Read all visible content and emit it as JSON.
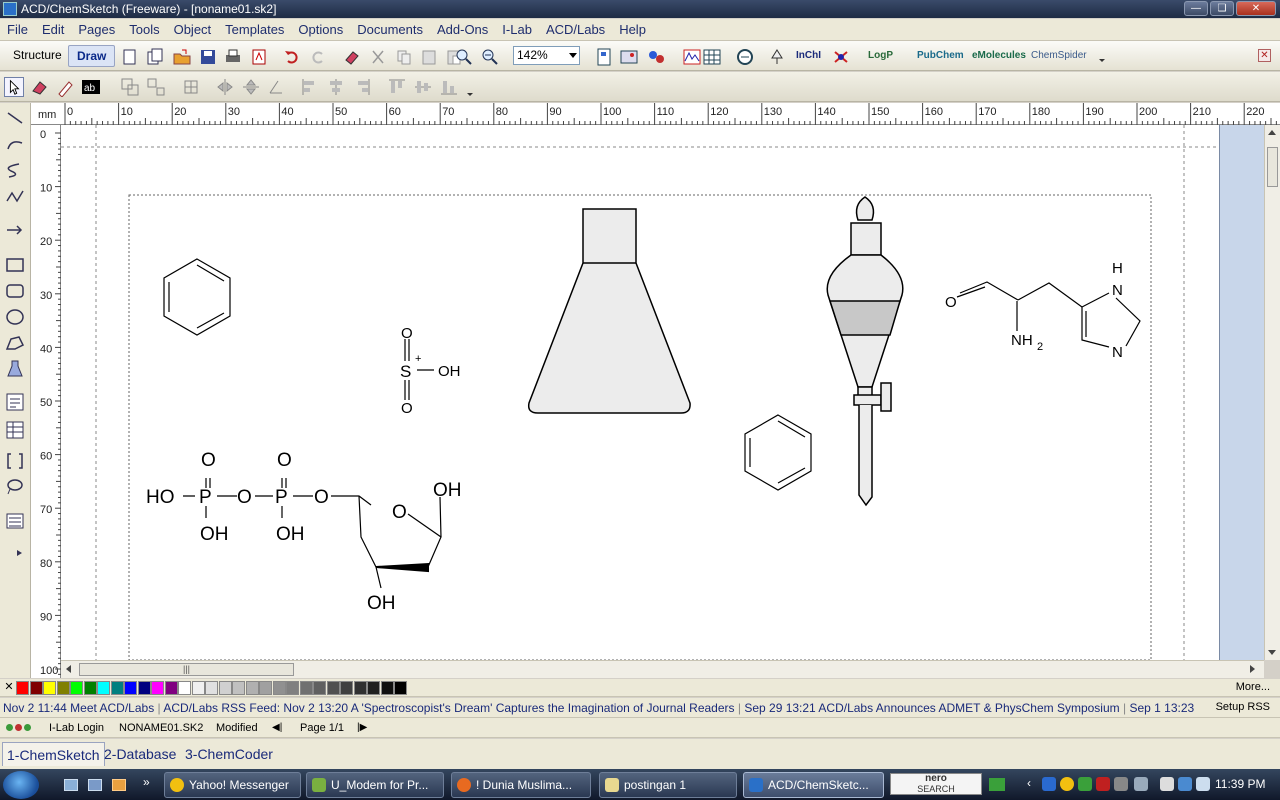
{
  "window": {
    "title": "ACD/ChemSketch (Freeware) - [noname01.sk2]"
  },
  "menu": [
    "File",
    "Edit",
    "Pages",
    "Tools",
    "Object",
    "Templates",
    "Options",
    "Documents",
    "Add-Ons",
    "I-Lab",
    "ACD/Labs",
    "Help"
  ],
  "toolbar1": {
    "structure_label": "Structure",
    "draw_label": "Draw",
    "zoom_value": "142%",
    "inchi_label": "InChI",
    "logp_label": "LogP",
    "pubchem_label": "PubChem",
    "emolecules_label": "eMolecules",
    "chemspider_label": "ChemSpider"
  },
  "hruler": {
    "unit": "mm",
    "ticks": [
      "0",
      "10",
      "20",
      "30",
      "40",
      "50",
      "60",
      "70",
      "80",
      "90",
      "100",
      "110",
      "120",
      "130",
      "140",
      "150",
      "160",
      "170",
      "180",
      "190",
      "200",
      "210",
      "220"
    ]
  },
  "vruler": {
    "ticks": [
      "0",
      "10",
      "20",
      "30",
      "40",
      "50",
      "60",
      "70",
      "80",
      "90",
      "100"
    ]
  },
  "molecules": {
    "sulfonic": {
      "o_top": "O",
      "s": "S",
      "charge": "+",
      "oh": "OH",
      "o_bottom": "O"
    },
    "sugar_phosphate": {
      "ho": "HO",
      "p1": "P",
      "o1": "O",
      "p2": "P",
      "o2": "O",
      "o_top1": "O",
      "o_top2": "O",
      "oh1": "OH",
      "oh2": "OH",
      "oh_right": "OH",
      "oh_bottom": "OH",
      "ring_o": "O"
    },
    "histidinal": {
      "o": "O",
      "nh2": "NH",
      "nh2_sub": "2",
      "h": "H",
      "n1": "N",
      "n2": "N"
    }
  },
  "palette": {
    "more_label": "More...",
    "colors": [
      "#ff0000",
      "#800000",
      "#ffff00",
      "#808000",
      "#00ff00",
      "#008000",
      "#00ffff",
      "#008080",
      "#0000ff",
      "#000080",
      "#ff00ff",
      "#800080",
      "#ffffff",
      "#f0f0f0",
      "#e0e0e0",
      "#d0d0d0",
      "#c0c0c0",
      "#b0b0b0",
      "#a0a0a0",
      "#909090",
      "#808080",
      "#707070",
      "#606060",
      "#505050",
      "#404040",
      "#303030",
      "#202020",
      "#101010",
      "#000000"
    ]
  },
  "news": {
    "items": [
      "Nov 2 11:44 Meet ACD/Labs",
      "ACD/Labs RSS Feed: Nov 2 13:20 A 'Spectroscopist's Dream' Captures the Imagination of Journal Readers",
      "Sep 29 13:21 ACD/Labs Announces ADMET & PhysChem Symposium",
      "Sep 1 13:23"
    ],
    "setup_label": "Setup RSS"
  },
  "status": {
    "login": "I-Lab Login",
    "file": "NONAME01.SK2",
    "state": "Modified",
    "page": "Page 1/1"
  },
  "apptabs": [
    "1-ChemSketch",
    "2-Database",
    "3-ChemCoder"
  ],
  "taskbar": {
    "items": [
      "Yahoo! Messenger",
      "U_Modem for Pr...",
      "! Dunia Muslima...",
      "postingan 1",
      "ACD/ChemSketc..."
    ],
    "nero_line1": "nero",
    "nero_line2": "SEARCH",
    "clock": "11:39 PM"
  }
}
